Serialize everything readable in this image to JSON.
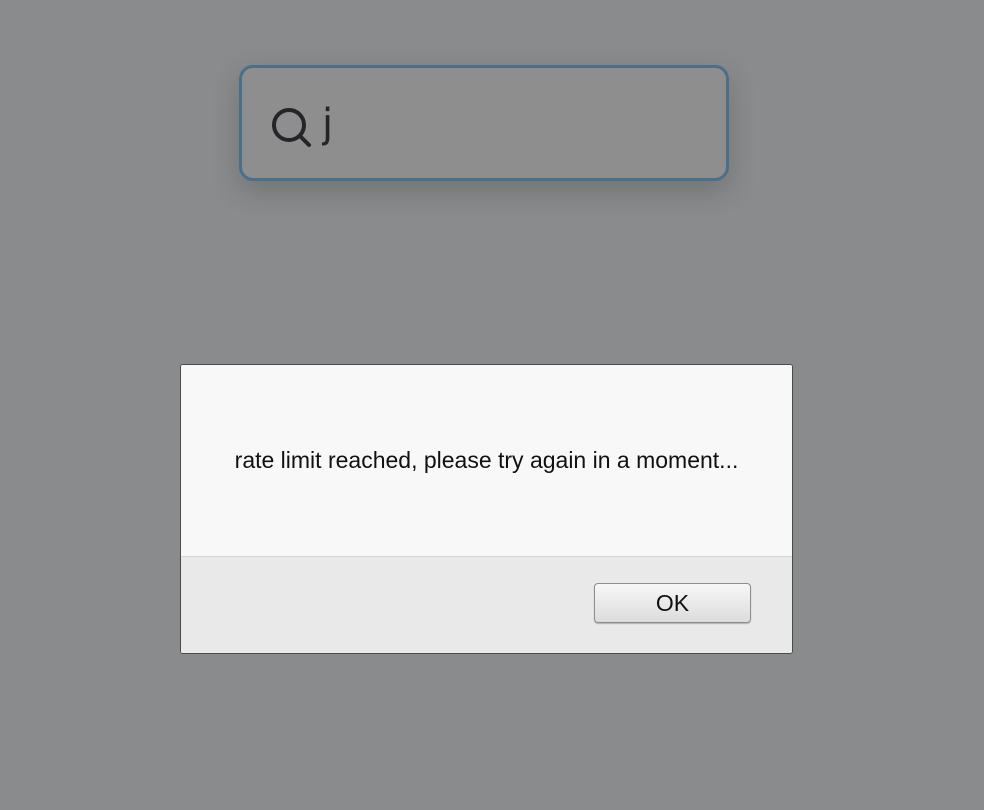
{
  "search": {
    "value": "j",
    "icon": "search-icon"
  },
  "dialog": {
    "message": "rate limit reached, please try again in a moment...",
    "ok_label": "OK"
  },
  "colors": {
    "backdrop": "#8a8b8c",
    "search_border": "#4a6f8a",
    "dialog_body": "#f8f8f8",
    "dialog_footer": "#e9e9e9"
  }
}
